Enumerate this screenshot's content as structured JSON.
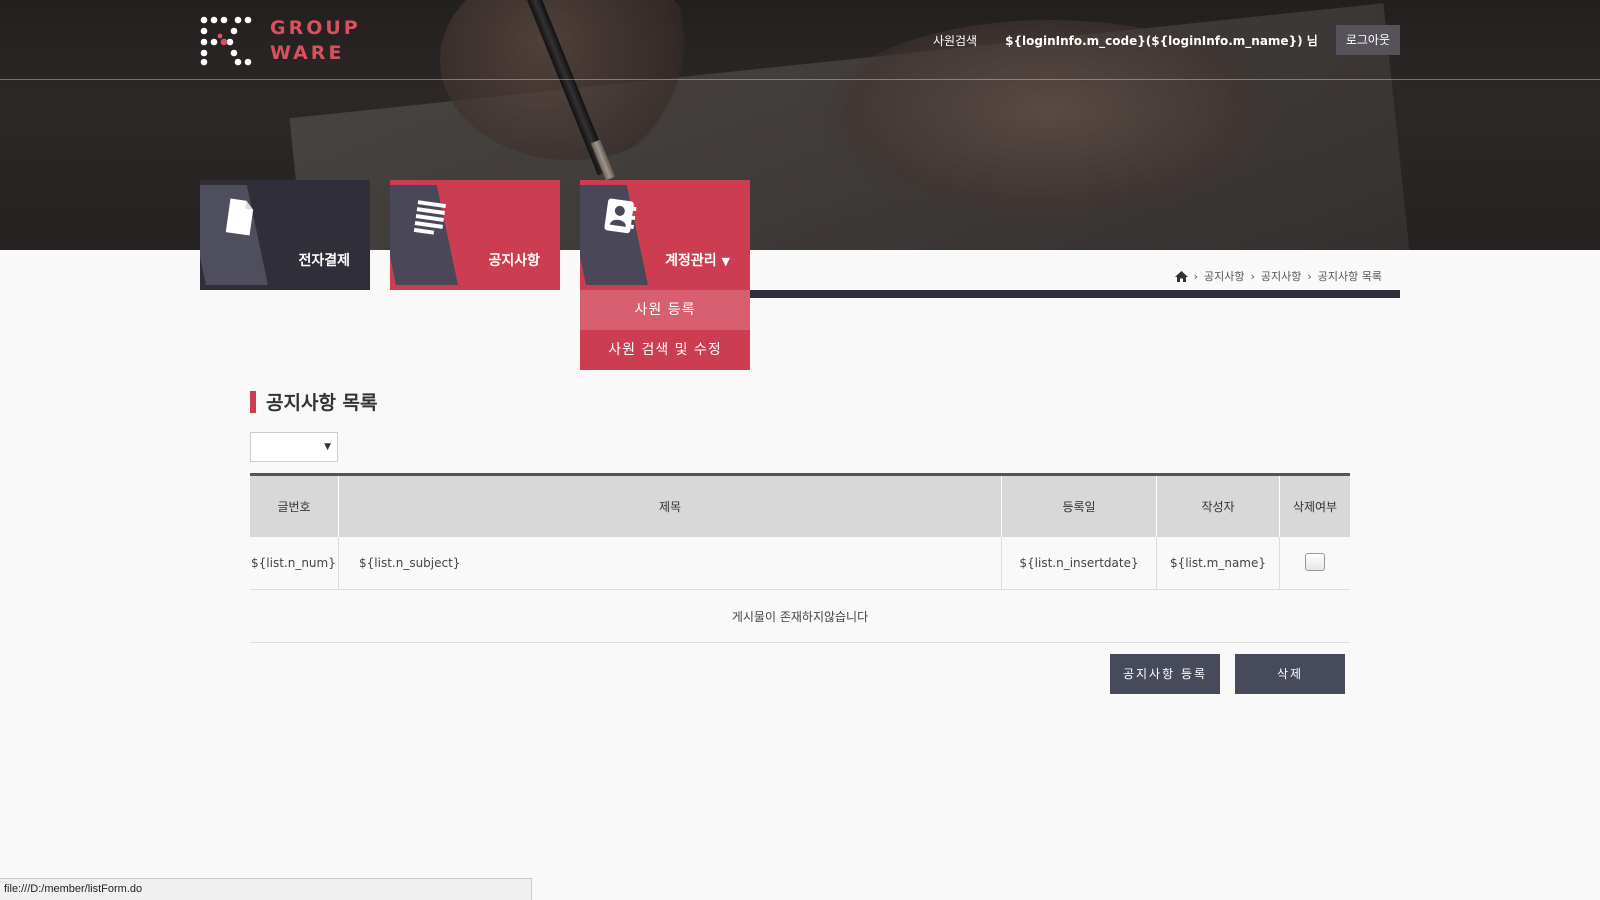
{
  "logo": {
    "line1": "GROUP",
    "line2": "WARE"
  },
  "header": {
    "employee_search": "사원검색",
    "user_greeting": "${loginInfo.m_code}(${loginInfo.m_name}) 님",
    "logout": "로그아웃"
  },
  "tiles": [
    {
      "label": "전자결제",
      "icon": "document-icon"
    },
    {
      "label": "공지사항",
      "icon": "list-document-icon"
    },
    {
      "label": "계정관리",
      "icon": "contact-book-icon",
      "caret": "▼"
    }
  ],
  "submenu": {
    "items": [
      "사원 등록",
      "사원 검색 및 수정"
    ]
  },
  "breadcrumb": {
    "items": [
      "공지사항",
      "공지사항",
      "공지사항 목록"
    ]
  },
  "page": {
    "title": "공지사항 목록"
  },
  "table": {
    "headers": [
      "글번호",
      "제목",
      "등록일",
      "작성자",
      "삭제여부"
    ],
    "row": {
      "num": "${list.n_num}",
      "subject": "${list.n_subject}",
      "insertdate": "${list.n_insertdate}",
      "name": "${list.m_name}"
    },
    "empty_message": "게시물이 존재하지않습니다"
  },
  "buttons": {
    "register": "공지사항 등록",
    "delete": "삭제"
  },
  "status_bar": {
    "url": "file:///D:/member/listForm.do"
  },
  "colors": {
    "accent": "#cd3d52",
    "dark": "#2f2e39",
    "button": "#474a5b"
  }
}
